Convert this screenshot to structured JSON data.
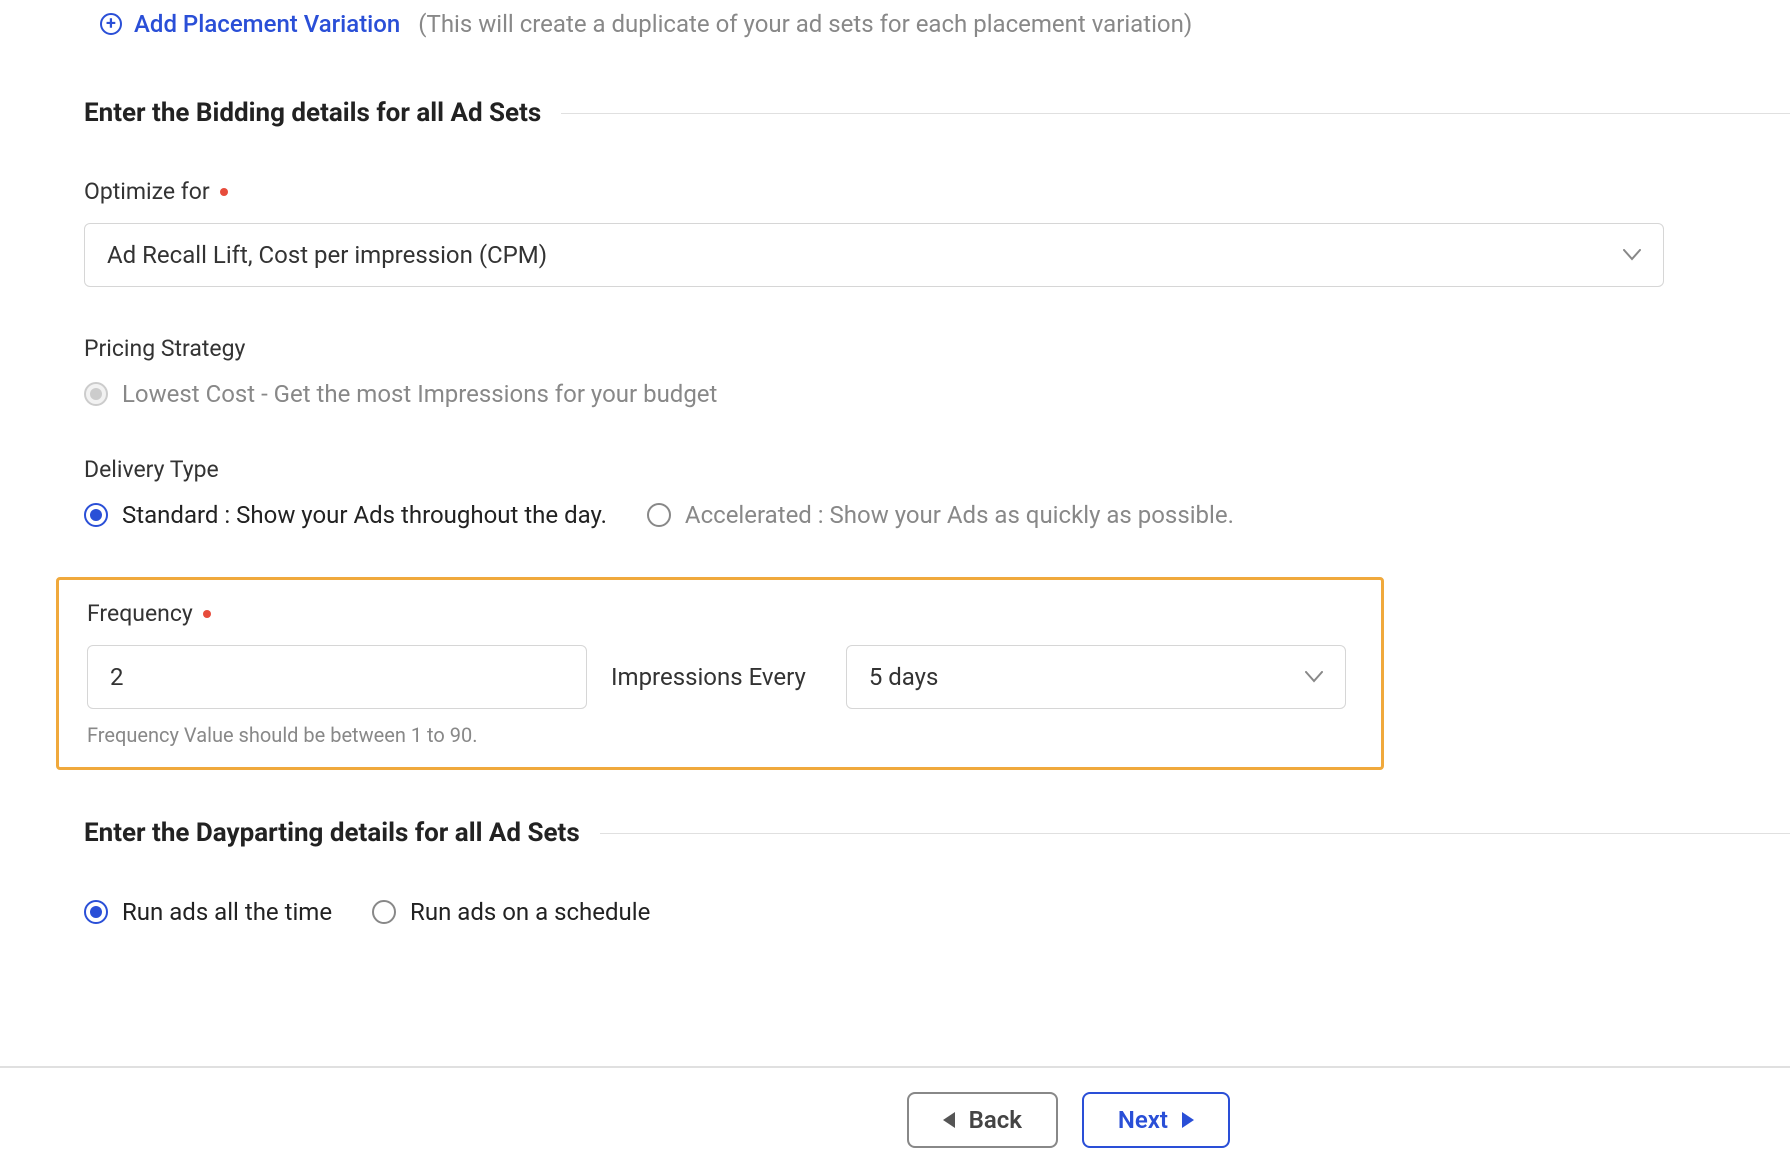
{
  "placement": {
    "link_label": "Add Placement Variation",
    "link_help": "(This will create a duplicate of your ad sets for each placement variation)"
  },
  "bidding": {
    "section_title": "Enter the Bidding details for all Ad Sets",
    "optimize": {
      "label": "Optimize for",
      "value": "Ad Recall Lift, Cost per impression (CPM)"
    },
    "pricing": {
      "label": "Pricing Strategy",
      "option": "Lowest Cost - Get the most Impressions for your budget"
    },
    "delivery": {
      "label": "Delivery Type",
      "standard": "Standard : Show your Ads throughout the day.",
      "accelerated": "Accelerated : Show your Ads as quickly as possible."
    },
    "frequency": {
      "label": "Frequency",
      "value": "2",
      "mid_label": "Impressions Every",
      "period": "5 days",
      "helper": "Frequency Value should be between 1 to 90."
    }
  },
  "dayparting": {
    "section_title": "Enter the Dayparting details for all Ad Sets",
    "opt_all": "Run ads all the time",
    "opt_schedule": "Run ads on a schedule"
  },
  "footer": {
    "back": "Back",
    "next": "Next"
  }
}
